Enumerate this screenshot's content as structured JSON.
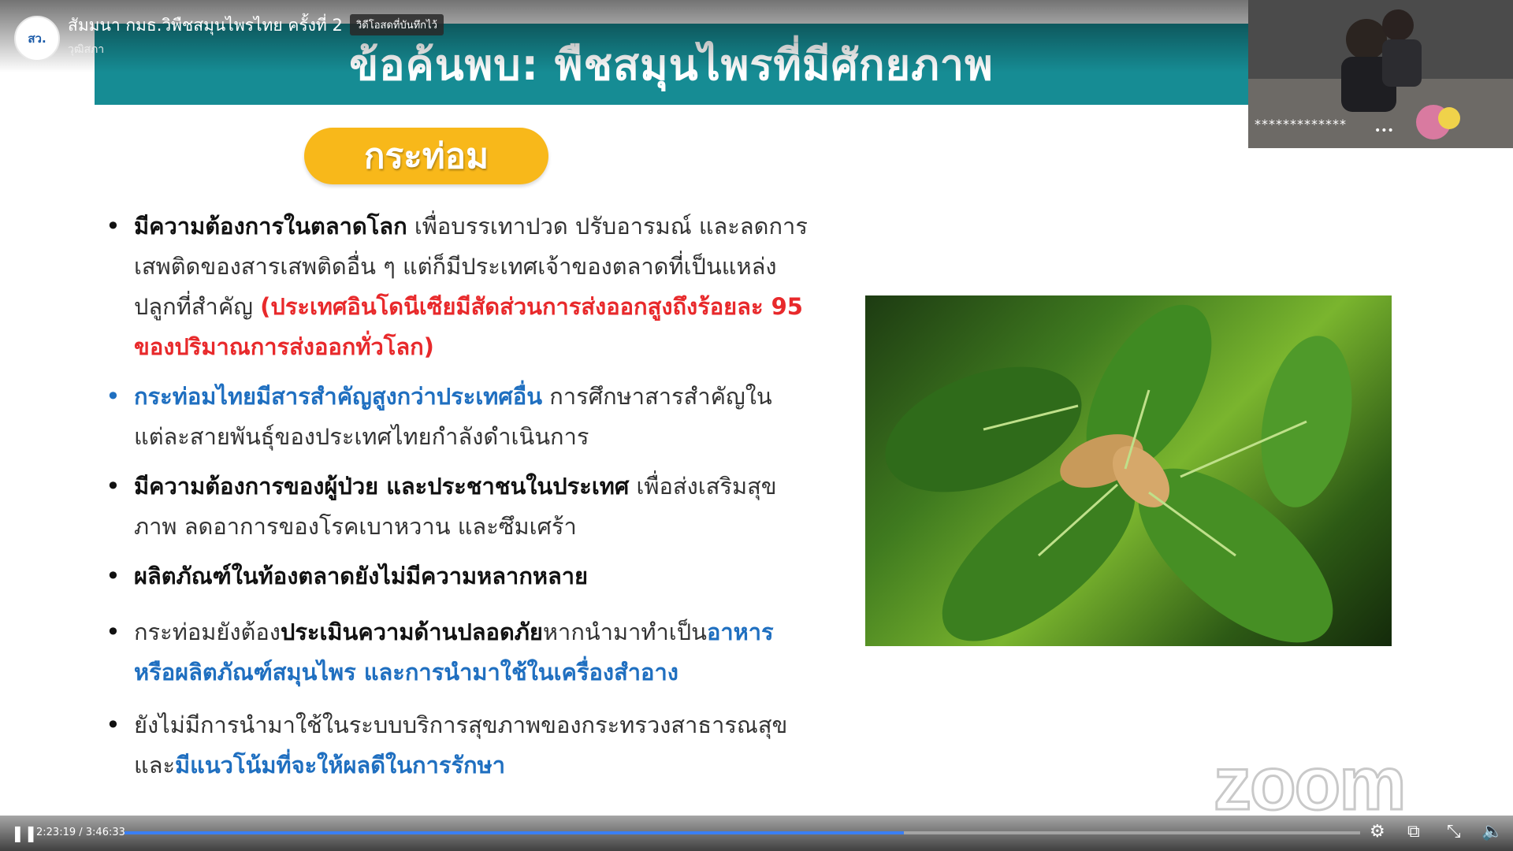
{
  "header": {
    "avatar_text": "สว.",
    "video_title": "สัมมนา กมธ.วิพืชสมุนไพรไทย ครั้งที่ 2",
    "live_badge": "วิดีโอสดที่บันทึกไว้",
    "channel_name": "วุฒิสภา",
    "more_label": "⋯"
  },
  "slide": {
    "title": "ข้อค้นพบ: พืชสมุนไพรที่มีศักยภาพ",
    "plant_name": "กระท่อม",
    "bullets": [
      {
        "bold": "มีความต้องการในตลาดโลก",
        "text": " เพื่อบรรเทาปวด ปรับอารมณ์ และลดการเสพติดของสารเสพติดอื่น ๆ แต่ก็มีประเทศเจ้าของตลาดที่เป็นแหล่งปลูกที่สำคัญ ",
        "red": "(ประเทศอินโดนีเซียมีสัดส่วนการส่งออกสูงถึงร้อยละ 95 ของปริมาณการส่งออกทั่วโลก)"
      },
      {
        "blue": "กระท่อมไทยมีสารสำคัญสูงกว่าประเทศอื่น",
        "text": "  การศึกษาสารสำคัญในแต่ละสายพันธุ์ของประเทศไทยกำลังดำเนินการ"
      },
      {
        "bold": "มีความต้องการของผู้ป่วย และประชาชนในประเทศ",
        "text": " เพื่อส่งเสริมสุขภาพ ลดอาการของโรคเบาหวาน และซึมเศร้า"
      },
      {
        "bold": "ผลิตภัณฑ์ในท้องตลาดยังไม่มีความหลากหลาย"
      },
      {
        "text1": "กระท่อมยังต้อง",
        "bold": "ประเมินความด้านปลอดภัย",
        "text2": "หากนำมาทำเป็น",
        "blue": "อาหาร หรือผลิตภัณฑ์สมุนไพร และการนำมาใช้ในเครื่องสำอาง"
      },
      {
        "text": "ยังไม่มีการนำมาใช้ในระบบบริการสุขภาพของกระทรวงสาธารณสุข และ",
        "blue": "มีแนวโน้มที่จะให้ผลดีในการรักษา"
      }
    ],
    "watermark": "zoom"
  },
  "webcam": {
    "label": "*************",
    "menu": "•••"
  },
  "player": {
    "play_icon": "❚❚",
    "current_time": "2:23:19",
    "duration": "3:46:33",
    "time_separator": " / ",
    "progress_fraction": 0.6307,
    "accent_color": "#3a7ff3"
  }
}
